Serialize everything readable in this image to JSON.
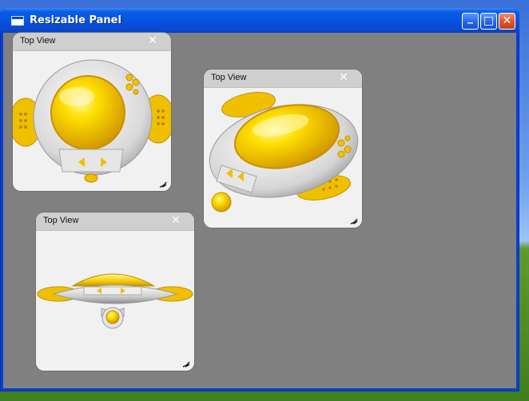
{
  "window": {
    "title": "Resizable Panel",
    "buttons": {
      "minimize": "_",
      "maximize": "□",
      "close": "✕"
    },
    "colors": {
      "client_background": "#808080",
      "titlebar": "#0554e0"
    }
  },
  "panels": [
    {
      "title": "Top View",
      "close_icon": "✕",
      "image": "yellow-gadget-front"
    },
    {
      "title": "Top View",
      "close_icon": "✕",
      "image": "yellow-gadget-angled"
    },
    {
      "title": "Top View",
      "close_icon": "✕",
      "image": "yellow-gadget-side"
    }
  ],
  "icons": {
    "app": "window-icon",
    "resize": "resize-grip-icon"
  },
  "colors": {
    "accent_yellow": "#f5c800",
    "body_silver": "#dcdcdc"
  }
}
